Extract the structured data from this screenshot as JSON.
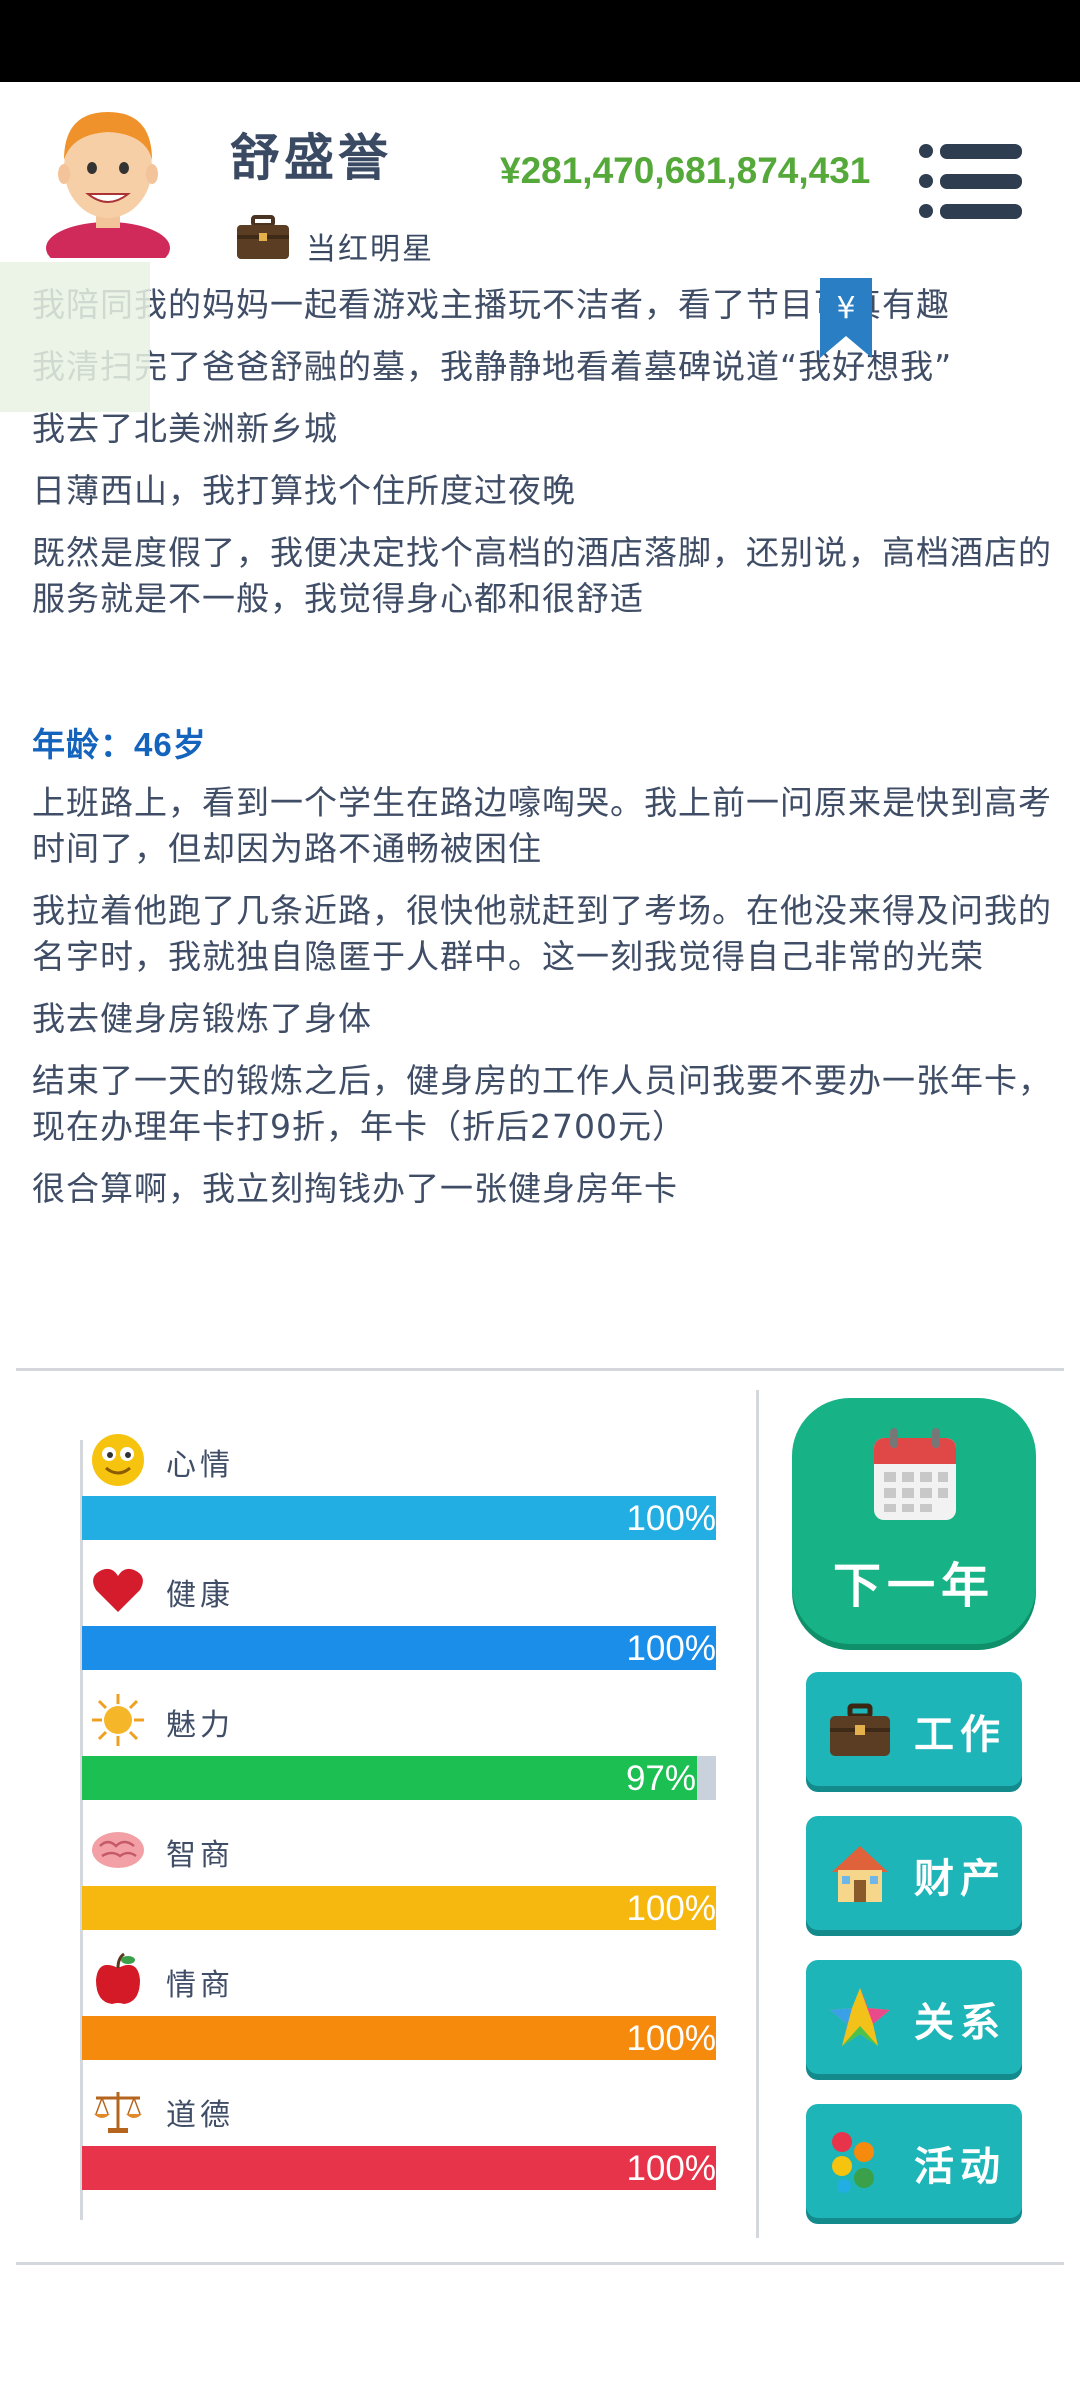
{
  "profile": {
    "name": "舒盛誉",
    "job_title": "当红明星",
    "money": "¥281,470,681,874,431",
    "money_color": "#55a83a"
  },
  "log": {
    "lines_before": [
      "我陪同我的妈妈一起看游戏主播玩不洁者，看了节目可真有趣",
      "我清扫完了爸爸舒融的墓，我静静地看着墓碑说道“我好想我”",
      "我去了北美洲新乡城",
      "日薄西山，我打算找个住所度过夜晚",
      "既然是度假了，我便决定找个高档的酒店落脚，还别说，高档酒店的服务就是不一般，我觉得身心都和很舒适"
    ],
    "age_label": "年龄：",
    "age_value": "46岁",
    "lines_after": [
      "上班路上，看到一个学生在路边嚎啕哭。我上前一问原来是快到高考时间了，但却因为路不通畅被困住",
      "我拉着他跑了几条近路，很快他就赶到了考场。在他没来得及问我的名字时，我就独自隐匿于人群中。这一刻我觉得自己非常的光荣",
      "我去健身房锻炼了身体",
      "结束了一天的锻炼之后，健身房的工作人员问我要不要办一张年卡，现在办理年卡打9折，年卡（折后2700元）",
      "很合算啊，我立刻掏钱办了一张健身房年卡"
    ]
  },
  "stats": [
    {
      "label": "心情",
      "icon": "smiley-icon",
      "percent_text": "100%",
      "value": 1.0,
      "color": "#23aee3"
    },
    {
      "label": "健康",
      "icon": "heart-icon",
      "percent_text": "100%",
      "value": 1.0,
      "color": "#1a8ee8"
    },
    {
      "label": "魅力",
      "icon": "sun-icon",
      "percent_text": "97%",
      "value": 0.97,
      "color": "#1cbf52"
    },
    {
      "label": "智商",
      "icon": "brain-icon",
      "percent_text": "100%",
      "value": 1.0,
      "color": "#f6b80f"
    },
    {
      "label": "情商",
      "icon": "apple-icon",
      "percent_text": "100%",
      "value": 1.0,
      "color": "#f58a0c"
    },
    {
      "label": "道德",
      "icon": "scale-icon",
      "percent_text": "100%",
      "value": 1.0,
      "color": "#e8344a"
    }
  ],
  "actions": {
    "next_year": "下一年",
    "work": "工作",
    "assets": "财产",
    "relations": "关系",
    "activities": "活动"
  }
}
